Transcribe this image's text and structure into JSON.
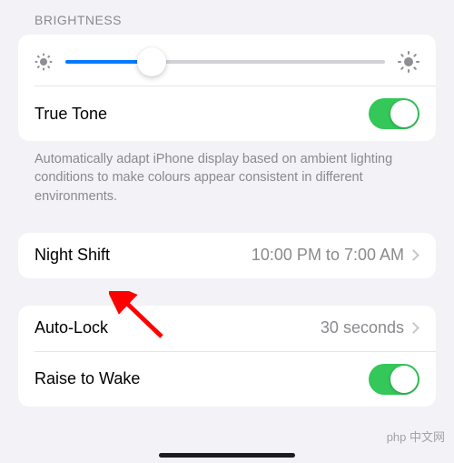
{
  "section_header": "BRIGHTNESS",
  "slider": {
    "percent": 27
  },
  "true_tone": {
    "label": "True Tone",
    "on": true
  },
  "footer": "Automatically adapt iPhone display based on ambient lighting conditions to make colours appear consistent in different environments.",
  "night_shift": {
    "label": "Night Shift",
    "value": "10:00 PM to 7:00 AM"
  },
  "auto_lock": {
    "label": "Auto-Lock",
    "value": "30 seconds"
  },
  "raise_to_wake": {
    "label": "Raise to Wake",
    "on": true
  },
  "watermark": "php 中文网"
}
